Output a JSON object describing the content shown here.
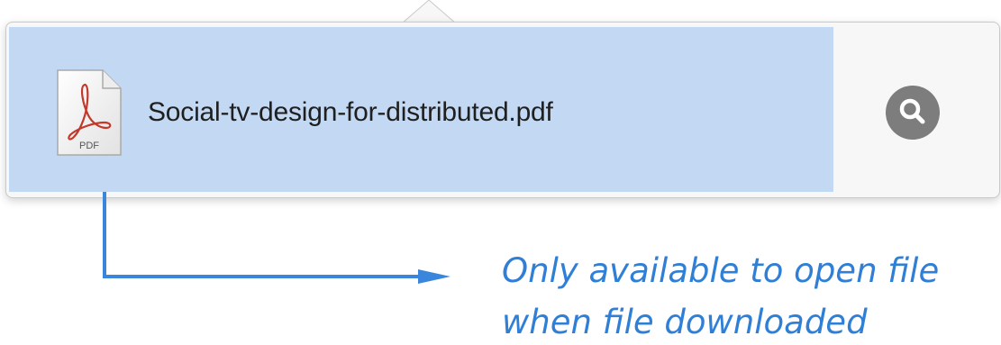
{
  "download": {
    "filename": "Social-tv-design-for-distributed.pdf",
    "file_type_label": "PDF",
    "icon": "pdf-file-icon",
    "reveal_icon": "magnifying-glass-icon"
  },
  "annotation": {
    "line1": "Only available to open file",
    "line2": "when file downloaded"
  },
  "colors": {
    "row_highlight": "#c3d8f2",
    "annotation": "#2f7fd6",
    "reveal_button": "#7d7d7d"
  }
}
